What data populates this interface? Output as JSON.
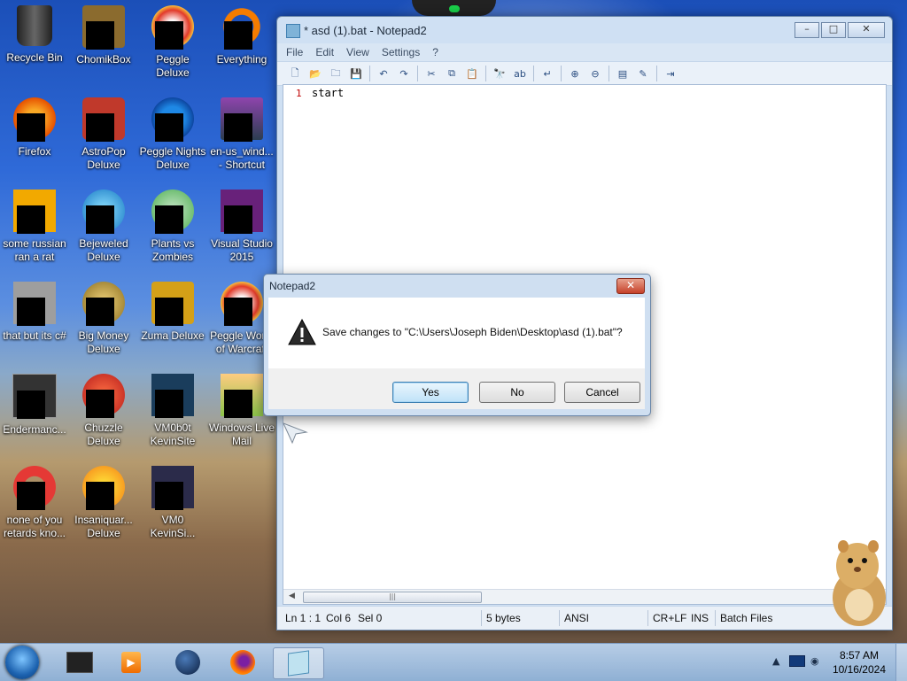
{
  "desktop": {
    "icons": [
      {
        "label": "Recycle Bin"
      },
      {
        "label": "ChomikBox"
      },
      {
        "label": "Peggle Deluxe"
      },
      {
        "label": "Everything"
      },
      {
        "label": "Firefox"
      },
      {
        "label": "AstroPop Deluxe"
      },
      {
        "label": "Peggle Nights Deluxe"
      },
      {
        "label": "en-us_wind... - Shortcut"
      },
      {
        "label": "some russian ran a rat"
      },
      {
        "label": "Bejeweled Deluxe"
      },
      {
        "label": "Plants vs Zombies"
      },
      {
        "label": "Visual Studio 2015"
      },
      {
        "label": "that but its c#"
      },
      {
        "label": "Big Money Deluxe"
      },
      {
        "label": "Zuma Deluxe"
      },
      {
        "label": "Peggle World of Warcraft"
      },
      {
        "label": "Endermanc..."
      },
      {
        "label": "Chuzzle Deluxe"
      },
      {
        "label": "VM0b0t KevinSite"
      },
      {
        "label": "Windows Live Mail"
      },
      {
        "label": "none of you retards kno..."
      },
      {
        "label": "Insaniquar... Deluxe"
      },
      {
        "label": "VM0 KevinSi..."
      }
    ]
  },
  "notepad": {
    "title": "* asd (1).bat - Notepad2",
    "menu": [
      "File",
      "Edit",
      "View",
      "Settings",
      "?"
    ],
    "editor": {
      "line_number": "1",
      "text": "start"
    },
    "status": {
      "position": "Ln 1 : 1",
      "col": "Col 6",
      "sel": "Sel 0",
      "size": "5 bytes",
      "encoding": "ANSI",
      "eol": "CR+LF",
      "mode": "INS",
      "scheme": "Batch Files"
    }
  },
  "dialog": {
    "title": "Notepad2",
    "message": "Save changes to \"C:\\Users\\Joseph Biden\\Desktop\\asd (1).bat\"?",
    "yes": "Yes",
    "no": "No",
    "cancel": "Cancel",
    "close_glyph": "✕"
  },
  "taskbar": {
    "time": "8:57 AM",
    "date": "10/16/2024"
  }
}
